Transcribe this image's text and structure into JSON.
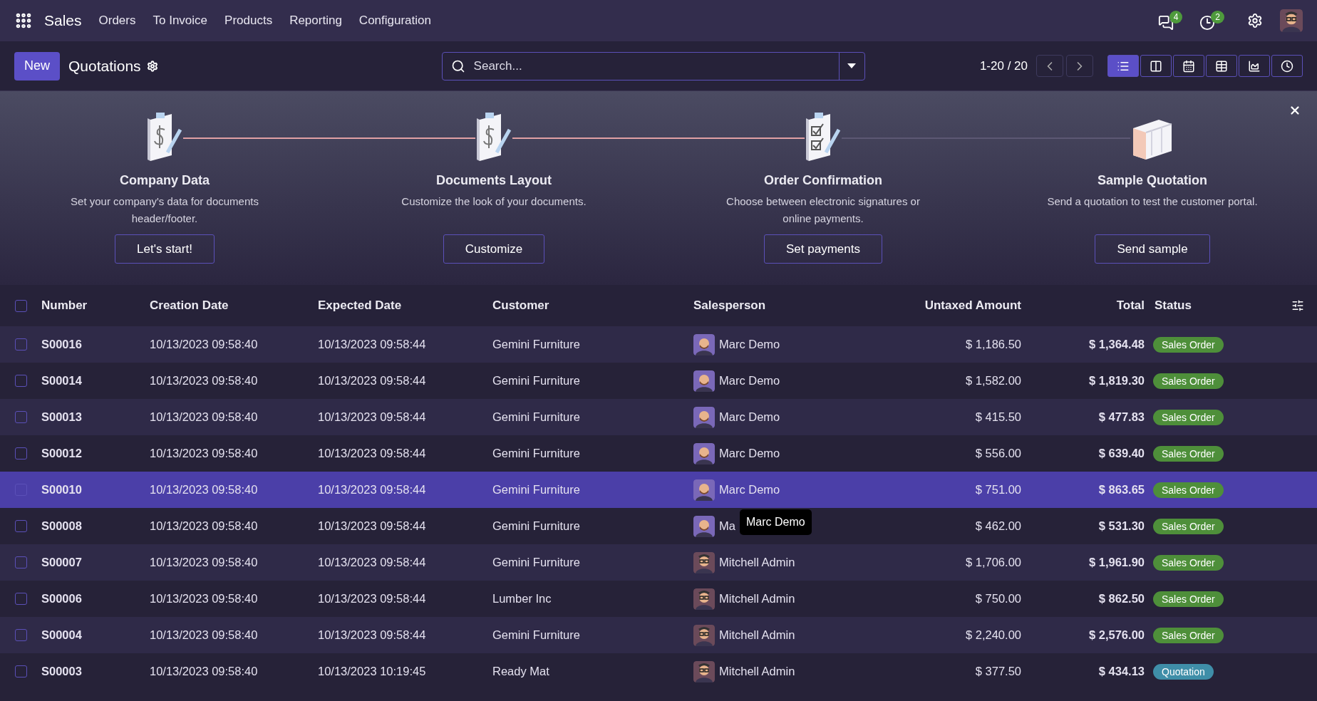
{
  "navbar": {
    "app": "Sales",
    "menu": [
      "Orders",
      "To Invoice",
      "Products",
      "Reporting",
      "Configuration"
    ],
    "messages_badge": "4",
    "activities_badge": "2"
  },
  "control_bar": {
    "new_button": "New",
    "title": "Quotations",
    "search": {
      "placeholder": "Search..."
    },
    "pager": "1-20 / 20",
    "views": [
      {
        "kind": "list",
        "selected": true
      },
      {
        "kind": "kanban",
        "selected": false
      },
      {
        "kind": "calendar",
        "selected": false
      },
      {
        "kind": "pivot",
        "selected": false
      },
      {
        "kind": "graph",
        "selected": false
      },
      {
        "kind": "activity",
        "selected": false
      }
    ]
  },
  "onboarding": {
    "steps": [
      {
        "kind": "dollar",
        "title": "Company Data",
        "description": "Set your company's data for documents header/footer.",
        "button": "Let's start!"
      },
      {
        "kind": "dollar",
        "title": "Documents Layout",
        "description": "Customize the look of your documents.",
        "button": "Customize"
      },
      {
        "kind": "checklist",
        "title": "Order Confirmation",
        "description": "Choose between electronic signatures or online payments.",
        "button": "Set payments"
      },
      {
        "kind": "box",
        "title": "Sample Quotation",
        "description": "Send a quotation to test the customer portal.",
        "button": "Send sample"
      }
    ]
  },
  "table": {
    "select_all": {
      "checked": false
    },
    "columns": [
      "Number",
      "Creation Date",
      "Expected Date",
      "Customer",
      "Salesperson",
      "Untaxed Amount",
      "Total",
      "Status"
    ],
    "rows": [
      {
        "selected": false,
        "checked": false,
        "number": "S00016",
        "created": "10/13/2023 09:58:40",
        "expected": "10/13/2023 09:58:44",
        "customer": "Gemini Furniture",
        "salesperson": {
          "name": "Marc Demo",
          "kind": "beard"
        },
        "untaxed": "$ 1,186.50",
        "total": "$ 1,364.48",
        "status": {
          "label": "Sales Order",
          "color": "#4e8f3a"
        }
      },
      {
        "selected": false,
        "checked": false,
        "number": "S00014",
        "created": "10/13/2023 09:58:40",
        "expected": "10/13/2023 09:58:44",
        "customer": "Gemini Furniture",
        "salesperson": {
          "name": "Marc Demo",
          "kind": "beard"
        },
        "untaxed": "$ 1,582.00",
        "total": "$ 1,819.30",
        "status": {
          "label": "Sales Order",
          "color": "#4e8f3a"
        }
      },
      {
        "selected": false,
        "checked": false,
        "number": "S00013",
        "created": "10/13/2023 09:58:40",
        "expected": "10/13/2023 09:58:44",
        "customer": "Gemini Furniture",
        "salesperson": {
          "name": "Marc Demo",
          "kind": "beard"
        },
        "untaxed": "$ 415.50",
        "total": "$ 477.83",
        "status": {
          "label": "Sales Order",
          "color": "#4e8f3a"
        }
      },
      {
        "selected": false,
        "checked": false,
        "number": "S00012",
        "created": "10/13/2023 09:58:40",
        "expected": "10/13/2023 09:58:44",
        "customer": "Gemini Furniture",
        "salesperson": {
          "name": "Marc Demo",
          "kind": "beard"
        },
        "untaxed": "$ 556.00",
        "total": "$ 639.40",
        "status": {
          "label": "Sales Order",
          "color": "#4e8f3a"
        }
      },
      {
        "selected": true,
        "checked": false,
        "number": "S00010",
        "created": "10/13/2023 09:58:40",
        "expected": "10/13/2023 09:58:44",
        "customer": "Gemini Furniture",
        "salesperson": {
          "name": "Marc Demo",
          "kind": "beard"
        },
        "untaxed": "$ 751.00",
        "total": "$ 863.65",
        "status": {
          "label": "Sales Order",
          "color": "#4e8f3a"
        },
        "tooltip": "Marc Demo"
      },
      {
        "selected": false,
        "checked": false,
        "number": "S00008",
        "created": "10/13/2023 09:58:40",
        "expected": "10/13/2023 09:58:44",
        "customer": "Gemini Furniture",
        "salesperson": {
          "name": "Ma",
          "kind": "beard"
        },
        "untaxed": "$ 462.00",
        "total": "$ 531.30",
        "status": {
          "label": "Sales Order",
          "color": "#4e8f3a"
        }
      },
      {
        "selected": false,
        "checked": false,
        "number": "S00007",
        "created": "10/13/2023 09:58:40",
        "expected": "10/13/2023 09:58:44",
        "customer": "Gemini Furniture",
        "salesperson": {
          "name": "Mitchell Admin",
          "kind": "glasses"
        },
        "untaxed": "$ 1,706.00",
        "total": "$ 1,961.90",
        "status": {
          "label": "Sales Order",
          "color": "#4e8f3a"
        }
      },
      {
        "selected": false,
        "checked": false,
        "number": "S00006",
        "created": "10/13/2023 09:58:40",
        "expected": "10/13/2023 09:58:44",
        "customer": "Lumber Inc",
        "salesperson": {
          "name": "Mitchell Admin",
          "kind": "glasses"
        },
        "untaxed": "$ 750.00",
        "total": "$ 862.50",
        "status": {
          "label": "Sales Order",
          "color": "#4e8f3a"
        }
      },
      {
        "selected": false,
        "checked": false,
        "number": "S00004",
        "created": "10/13/2023 09:58:40",
        "expected": "10/13/2023 09:58:44",
        "customer": "Gemini Furniture",
        "salesperson": {
          "name": "Mitchell Admin",
          "kind": "glasses"
        },
        "untaxed": "$ 2,240.00",
        "total": "$ 2,576.00",
        "status": {
          "label": "Sales Order",
          "color": "#4e8f3a"
        }
      },
      {
        "selected": false,
        "checked": false,
        "number": "S00003",
        "created": "10/13/2023 09:58:40",
        "expected": "10/13/2023 10:19:45",
        "customer": "Ready Mat",
        "salesperson": {
          "name": "Mitchell Admin",
          "kind": "glasses"
        },
        "untaxed": "$ 377.50",
        "total": "$ 434.13",
        "status": {
          "label": "Quotation",
          "color": "#3f8ea8"
        }
      }
    ]
  }
}
